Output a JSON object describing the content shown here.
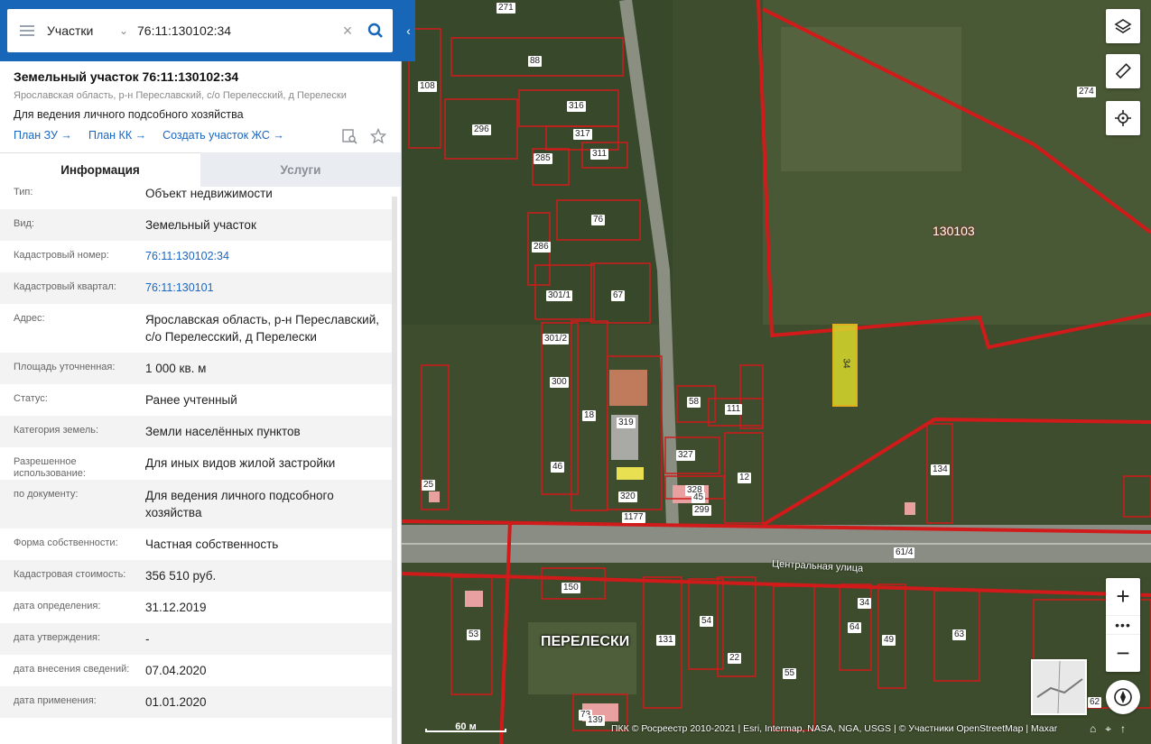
{
  "search": {
    "category": "Участки",
    "query": "76:11:130102:34"
  },
  "object": {
    "title": "Земельный участок 76:11:130102:34",
    "address": "Ярославская область, р-н Переславский, с/о Перелесский, д Перелески",
    "use": "Для ведения личного подсобного хозяйства",
    "links": [
      "План ЗУ →",
      "План КК →",
      "Создать участок ЖС →"
    ]
  },
  "tabs": [
    "Информация",
    "Услуги"
  ],
  "info": [
    {
      "k": "Тип:",
      "v": "Объект недвижимости"
    },
    {
      "k": "Вид:",
      "v": "Земельный участок"
    },
    {
      "k": "Кадастровый номер:",
      "v": "76:11:130102:34"
    },
    {
      "k": "Кадастровый квартал:",
      "v": "76:11:130101"
    },
    {
      "k": "Адрес:",
      "v": "Ярославская область, р-н Переславский, с/о Перелесский, д Перелески"
    },
    {
      "k": "Площадь уточненная:",
      "v": "1 000 кв. м"
    },
    {
      "k": "Статус:",
      "v": "Ранее учтенный"
    },
    {
      "k": "Категория земель:",
      "v": "Земли населённых пунктов"
    },
    {
      "k": "Разрешенное использование:",
      "v": "Для иных видов жилой застройки"
    },
    {
      "k": "по документу:",
      "v": "Для ведения личного подсобного хозяйства"
    },
    {
      "k": "Форма собственности:",
      "v": "Частная собственность"
    },
    {
      "k": "Кадастровая стоимость:",
      "v": "356 510 руб."
    },
    {
      "k": "дата определения:",
      "v": "31.12.2019"
    },
    {
      "k": "дата утверждения:",
      "v": "-"
    },
    {
      "k": "дата внесения сведений:",
      "v": "07.04.2020"
    },
    {
      "k": "дата применения:",
      "v": "01.01.2020"
    }
  ],
  "map": {
    "village_label": "ПЕРЕЛЕСКИ",
    "street_label": "Центральная улица",
    "quarter_label": "130103",
    "scale_label": "60 м",
    "attribution": "ПКК © Росреестр 2010-2021 | Esri, Intermap, NASA, NGA, USGS | © Участники OpenStreetMap | Maxar",
    "parcel_numbers": [
      "271",
      "88",
      "108",
      "274",
      "316",
      "296",
      "317",
      "311",
      "285",
      "76",
      "286",
      "301/1",
      "67",
      "301/2",
      "300",
      "18",
      "319",
      "58",
      "111",
      "34",
      "327",
      "12",
      "134",
      "25",
      "46",
      "328",
      "45",
      "299",
      "320",
      "1177",
      "61/4",
      "150",
      "53",
      "54",
      "22",
      "55",
      "64",
      "49",
      "63",
      "131",
      "73",
      "139",
      "62",
      "34",
      "130103"
    ],
    "selected_parcel_color": "#d9d92a",
    "border_color": "#d11a1a"
  }
}
